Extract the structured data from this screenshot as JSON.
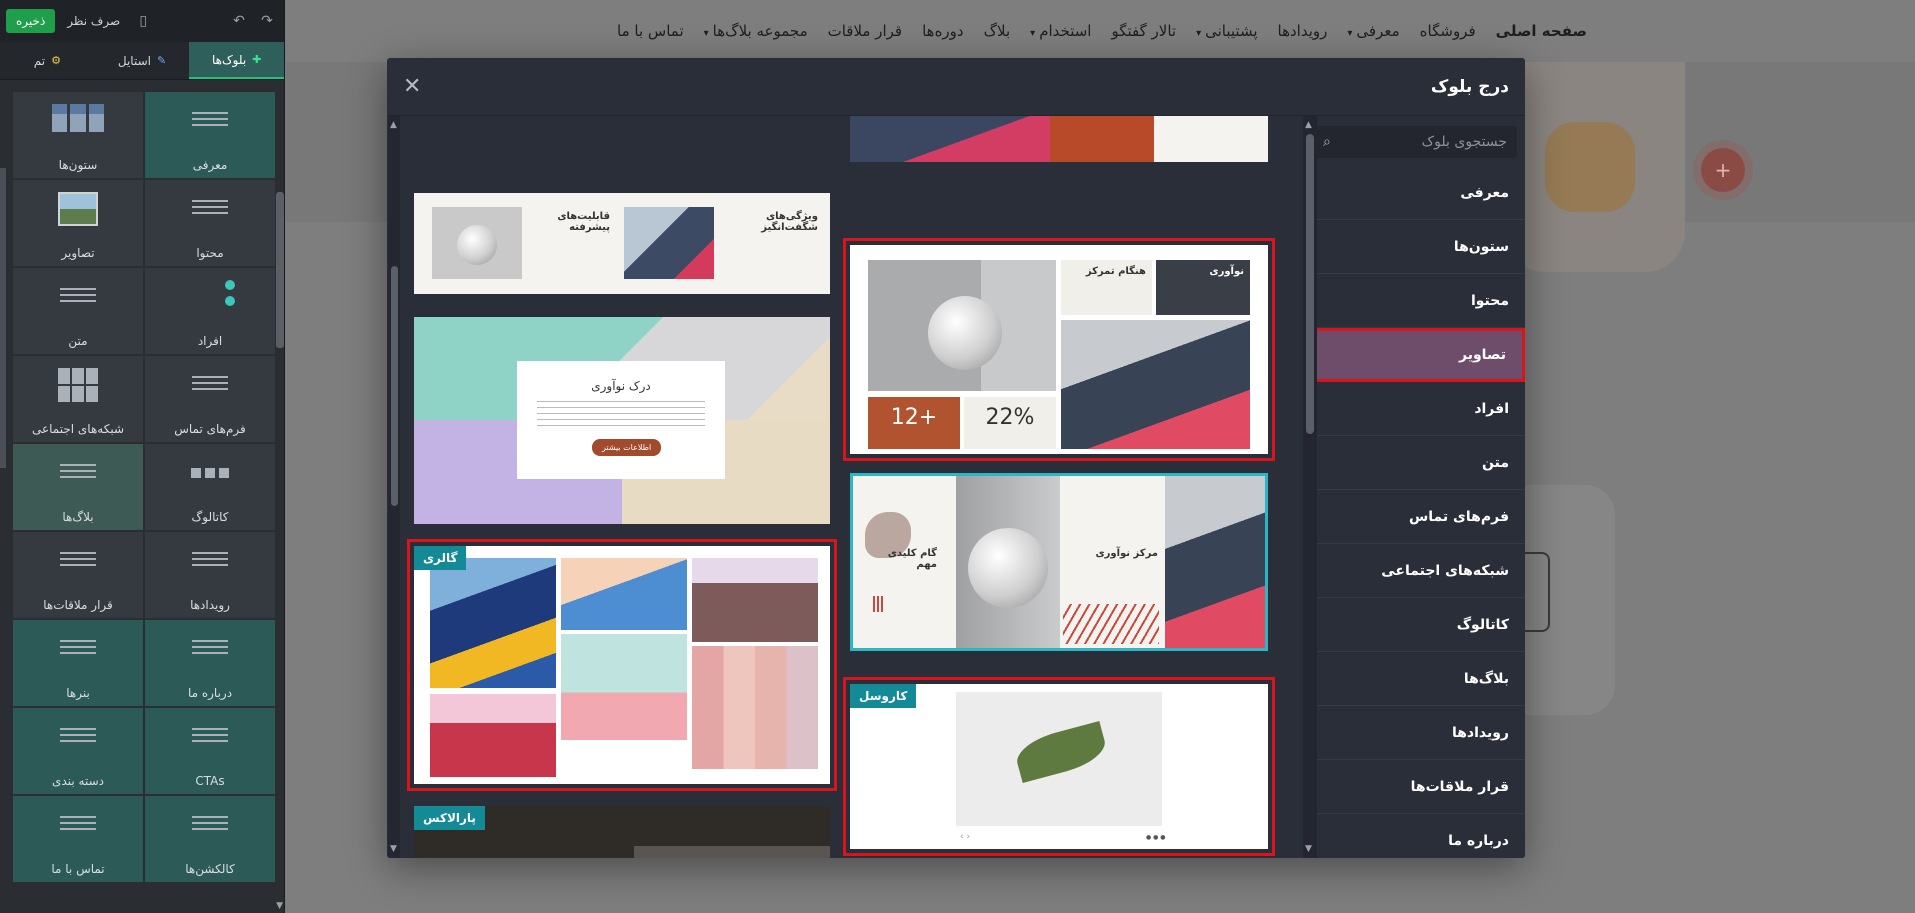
{
  "toolbar": {
    "save_label": "ذخیره",
    "discard_label": "صرف نظر"
  },
  "tabs": [
    {
      "label": "بلوک‌ها",
      "icon": "plus-icon"
    },
    {
      "label": "استایل",
      "icon": "brush-icon"
    },
    {
      "label": "تم",
      "icon": "gear-icon"
    }
  ],
  "sidebar_blocks": [
    "معرفی",
    "ستون‌ها",
    "محتوا",
    "تصاویر",
    "افراد",
    "متن",
    "فرم‌های تماس",
    "شبکه‌های اجتماعی",
    "کاتالوگ",
    "بلاگ‌ها",
    "رویدادها",
    "قرار ملاقات‌ها",
    "درباره ما",
    "بنرها",
    "CTAs",
    "دسته بندی",
    "کالکشن‌ها",
    "تماس با ما"
  ],
  "site_nav": [
    "صفحه اصلی",
    "فروشگاه",
    "معرفی",
    "رویدادها",
    "پشتیبانی",
    "تالار گفتگو",
    "استخدام",
    "بلاگ",
    "دوره‌ها",
    "قرار ملاقات",
    "مجموعه بلاگ‌ها",
    "تماس با ما"
  ],
  "modal": {
    "title": "درج بلوک",
    "search_placeholder": "جستجوی بلوک",
    "categories": [
      "معرفی",
      "ستون‌ها",
      "محتوا",
      "تصاویر",
      "افراد",
      "متن",
      "فرم‌های تماس",
      "شبکه‌های اجتماعی",
      "کاتالوگ",
      "بلاگ‌ها",
      "رویدادها",
      "قرار ملاقات‌ها",
      "درباره ما"
    ],
    "active_category": "تصاویر",
    "badges": {
      "gallery": "گالری",
      "carousel": "کاروسل",
      "parallax": "پارالاکس"
    },
    "card_texts": {
      "advanced_features": "قابلیت‌های پیشرفته",
      "amazing_features": "ویژگی‌های شگفت‌انگیز",
      "understand_innovation": "درک نوآوری",
      "learn_more": "اطلاعات بیشتر",
      "innovation": "نوآوری",
      "focus_time": "هنگام تمرکز",
      "stat_1": "12+",
      "stat_2": "22%",
      "key_step": "گام کلیدی مهم",
      "innovation_center": "مرکز نوآوری"
    }
  },
  "colors": {
    "accent_green": "#1f9e4c",
    "teal": "#138a95",
    "highlight_red": "#d8141c",
    "active_category_bg": "#6e4d6b"
  }
}
